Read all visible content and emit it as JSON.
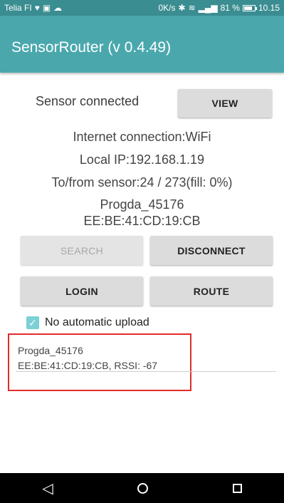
{
  "status_bar": {
    "carrier": "Telia FI",
    "speed": "0K/s",
    "battery": "81 %",
    "time": "10.15",
    "battery_level": 0.81
  },
  "app": {
    "title": "SensorRouter (v 0.4.49)"
  },
  "main": {
    "sensor_status": "Sensor connected",
    "view_label": "VIEW",
    "internet": "Internet connection:WiFi",
    "local_ip": "Local IP:192.168.1.19",
    "to_from": "To/from sensor:24 / 273(fill: 0%)",
    "device_name": "Progda_45176",
    "device_mac": "EE:BE:41:CD:19:CB",
    "buttons": {
      "search": "SEARCH",
      "disconnect": "DISCONNECT",
      "login": "LOGIN",
      "route": "ROUTE"
    },
    "checkbox_label": "No automatic upload",
    "checkbox_checked": true
  },
  "devices": [
    {
      "name": "Progda_45176",
      "details": "EE:BE:41:CD:19:CB, RSSI: -67"
    }
  ],
  "nav_icons": [
    "back-icon",
    "home-icon",
    "recents-icon"
  ],
  "colors": {
    "status_bar": "#3a8d91",
    "app_bar": "#4aa8ad",
    "checkbox": "#7ad0d5",
    "highlight": "#e32b2b"
  }
}
